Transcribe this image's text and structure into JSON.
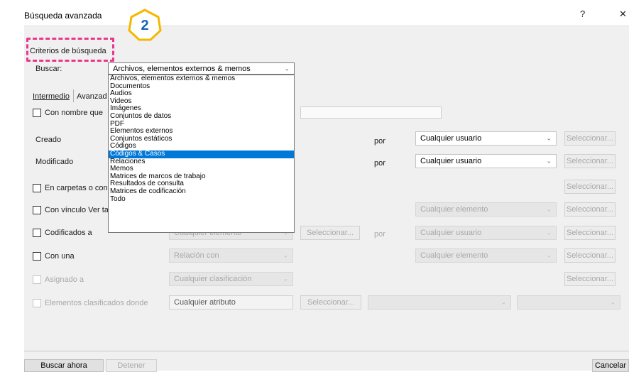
{
  "window": {
    "title": "Búsqueda avanzada",
    "help_glyph": "?",
    "close_glyph": "✕"
  },
  "annotation": {
    "step_number": "2",
    "color": "#e8378c",
    "ring_color": "#f5b800",
    "text_color": "#1b63b5"
  },
  "criteria": {
    "heading": "Criterios de búsqueda",
    "search_label": "Buscar:",
    "search_value": "Archivos, elementos externos & memos",
    "options": [
      "Archivos, elementos externos & memos",
      "Documentos",
      "Audios",
      "Videos",
      "Imágenes",
      "Conjuntos de datos",
      "PDF",
      "Elementos externos",
      "Conjuntos estáticos",
      "Códigos",
      "Códigos & Casos",
      "Relaciones",
      "Memos",
      "Matrices de marcos de trabajo",
      "Resultados de consulta",
      "Matrices de codificación",
      "Todo"
    ],
    "selected_option": "Códigos & Casos"
  },
  "tabs": {
    "intermedio": "Intermedio",
    "avanzado": "Avanzad"
  },
  "rows": {
    "con_nombre": "Con nombre que",
    "creado": "Creado",
    "modificado": "Modificado",
    "en_carpetas": "En carpetas o con",
    "con_vinculo": "Con vínculo Ver ta",
    "codificados": "Codificados a",
    "con_una": "Con una",
    "asignado": "Asignado a",
    "clasificados": "Elementos clasificados donde"
  },
  "common": {
    "por": "por",
    "seleccionar": "Seleccionar...",
    "cualquier_usuario": "Cualquier usuario",
    "cualquier_elemento": "Cualquier elemento",
    "relacion_con": "Relación con",
    "cualquier_clasificacion": "Cualquier clasificación",
    "cualquier_atributo": "Cualquier atributo"
  },
  "footer": {
    "buscar_ahora": "Buscar ahora",
    "detener": "Detener",
    "cancelar": "Cancelar"
  },
  "colors": {
    "selection": "#0078d7",
    "dialog_bg": "#f0f0f0"
  }
}
